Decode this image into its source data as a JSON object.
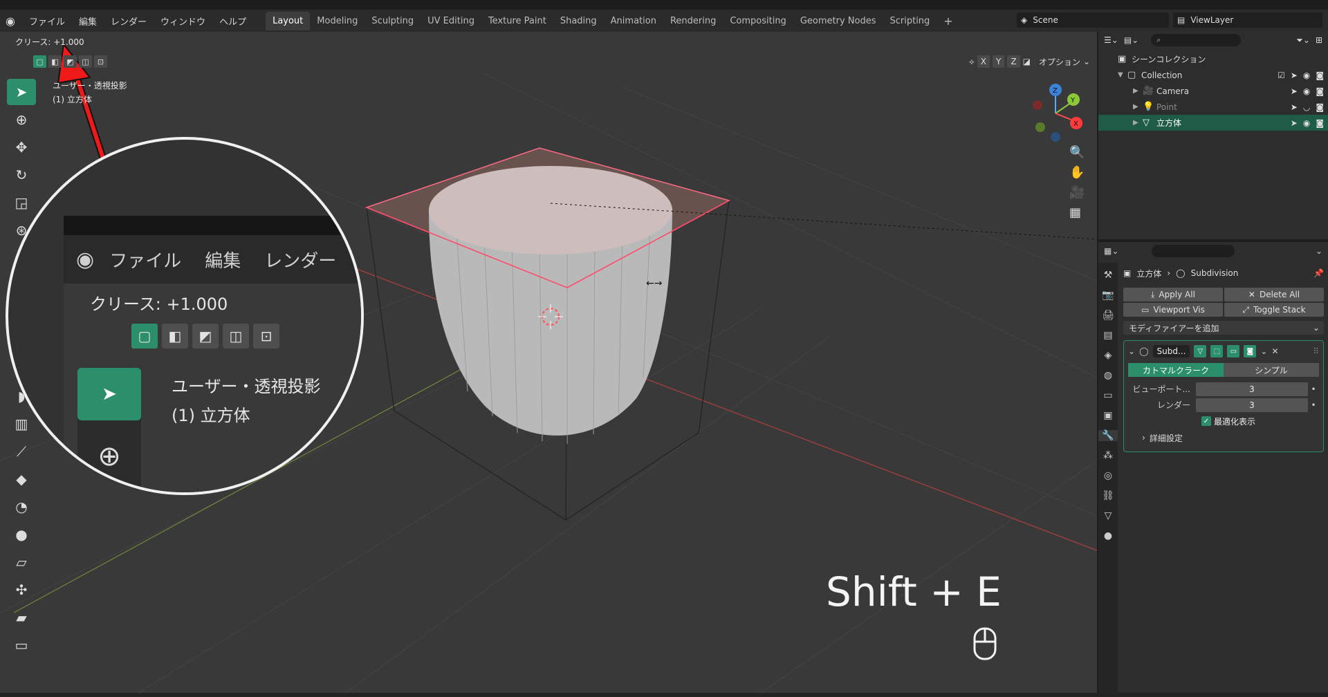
{
  "topbar": {
    "menus": [
      "ファイル",
      "編集",
      "レンダー",
      "ウィンドウ",
      "ヘルプ"
    ],
    "workspaces": [
      "Layout",
      "Modeling",
      "Sculpting",
      "UV Editing",
      "Texture Paint",
      "Shading",
      "Animation",
      "Rendering",
      "Compositing",
      "Geometry Nodes",
      "Scripting"
    ],
    "active_workspace": "Layout",
    "scene": "Scene",
    "view_layer": "ViewLayer"
  },
  "viewport": {
    "crease_readout": "クリース: +1.000",
    "view_name": "ユーザー・透視投影",
    "object_info": "(1) 立方体",
    "axes": [
      "X",
      "Y",
      "Z"
    ],
    "options_label": "オプション",
    "gizmo_axes": [
      "Z",
      "Y",
      "X"
    ]
  },
  "magnifier": {
    "menus": [
      "ファイル",
      "編集",
      "レンダー"
    ],
    "crease_readout": "クリース: +1.000",
    "view_name": "ユーザー・透視投影",
    "object_info": "(1) 立方体"
  },
  "shortcut": "Shift + E",
  "outliner": {
    "root": "シーンコレクション",
    "collection": "Collection",
    "items": [
      {
        "name": "Camera",
        "selected": false,
        "dim": false
      },
      {
        "name": "Point",
        "selected": false,
        "dim": true
      },
      {
        "name": "立方体",
        "selected": true,
        "dim": false
      }
    ]
  },
  "properties": {
    "object": "立方体",
    "modifier_path": "Subdivision",
    "buttons": {
      "apply_all": "Apply All",
      "delete_all": "Delete All",
      "viewport_vis": "Viewport Vis",
      "toggle_stack": "Toggle Stack"
    },
    "add_modifier": "モディファイアーを追加",
    "modifier": {
      "name": "Subd...",
      "modes": [
        "カトマルクラーク",
        "シンプル"
      ],
      "active_mode": "カトマルクラーク",
      "fields": [
        {
          "label": "ビューポート...",
          "value": "3"
        },
        {
          "label": "レンダー",
          "value": "3"
        }
      ],
      "optimal_display": "最適化表示",
      "advanced": "詳細設定"
    }
  },
  "colors": {
    "accent": "#2b8f6b",
    "selection_red": "#ff3b3b",
    "viewport_bg": "#393939"
  }
}
